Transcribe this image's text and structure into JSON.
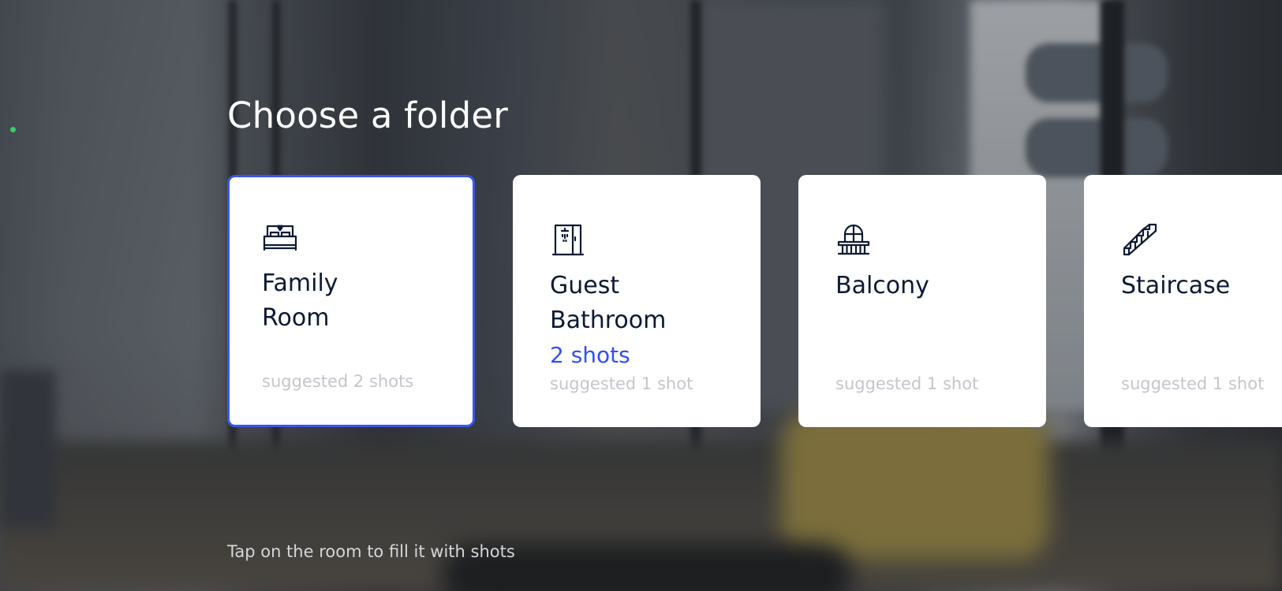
{
  "title": "Choose a folder",
  "hint": "Tap on the room to fill it with shots",
  "colors": {
    "accent": "#3b57e8",
    "shots_text": "#3050f0",
    "card_title": "#0c1a33",
    "suggested_text": "#c3c6cc",
    "status_dot": "#2fd36a"
  },
  "folders": [
    {
      "name": "Family Room",
      "icon": "bed-icon",
      "shots": "",
      "suggested": "suggested 2 shots",
      "selected": true
    },
    {
      "name": "Guest Bathroom",
      "icon": "shower-icon",
      "shots": "2 shots",
      "suggested": "suggested 1 shot",
      "selected": false
    },
    {
      "name": "Balcony",
      "icon": "balcony-icon",
      "shots": "",
      "suggested": "suggested 1 shot",
      "selected": false
    },
    {
      "name": "Staircase",
      "icon": "stairs-icon",
      "shots": "",
      "suggested": "suggested 1 shot",
      "selected": false
    }
  ]
}
